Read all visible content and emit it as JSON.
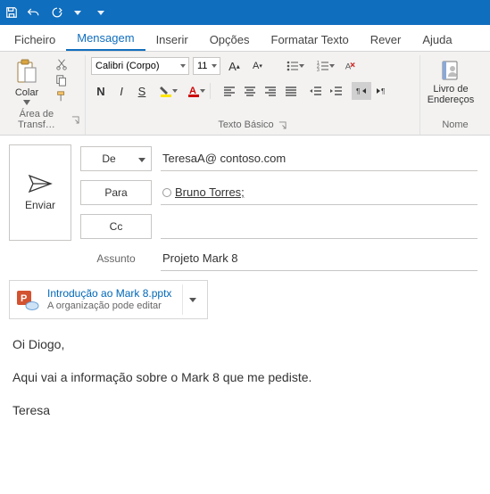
{
  "titlebar": {
    "save_icon": "save",
    "undo_icon": "undo",
    "redo_icon": "redo"
  },
  "tabs": {
    "ficheiro": "Ficheiro",
    "mensagem": "Mensagem",
    "inserir": "Inserir",
    "opcoes": "Opções",
    "formatar": "Formatar Texto",
    "rever": "Rever",
    "ajuda": "Ajuda"
  },
  "ribbon": {
    "paste_label": "Colar",
    "clipboard_group": "Área de Transf…",
    "font_name": "Calibri (Corpo)",
    "font_size": "11",
    "basic_text_group": "Texto Básico",
    "addressbook_line1": "Livro de",
    "addressbook_line2": "Endereços",
    "names_group": "Nome"
  },
  "compose": {
    "send": "Enviar",
    "from_label": "De",
    "from_value": "TeresaA@ contoso.com",
    "to_label": "Para",
    "to_value": "Bruno Torres;",
    "cc_label": "Cc",
    "cc_value": "",
    "subject_label": "Assunto",
    "subject_value": "Projeto Mark 8"
  },
  "attachment": {
    "name": "Introdução ao Mark 8.pptx",
    "subtitle": "A organização pode editar"
  },
  "body": {
    "p1": "Oi Diogo,",
    "p2": "Aqui vai a informação sobre o Mark 8 que me pediste.",
    "p3": "Teresa"
  }
}
